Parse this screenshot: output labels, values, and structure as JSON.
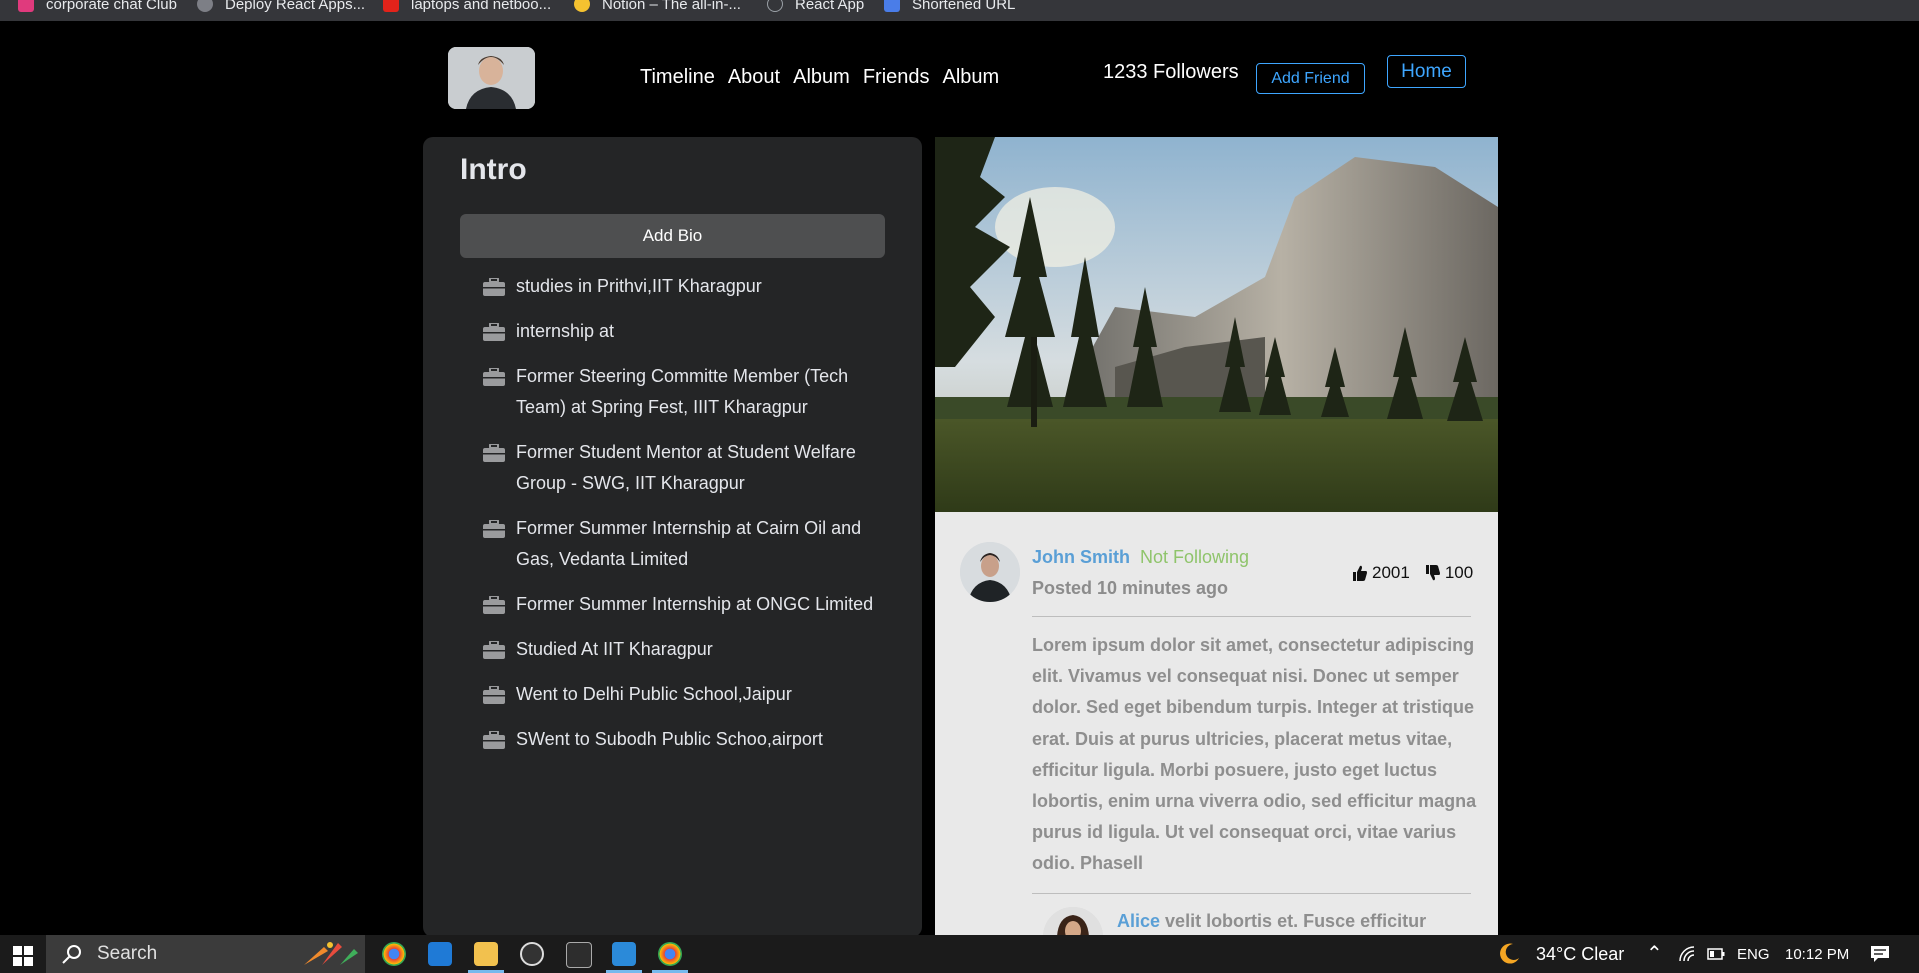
{
  "bookmarks": [
    {
      "label": "corporate chat Club",
      "icon": "purple-app-icon"
    },
    {
      "label": "Deploy React Apps...",
      "icon": "gear-like-icon"
    },
    {
      "label": "laptops and netboo...",
      "icon": "red-e-icon"
    },
    {
      "label": "Notion – The all-in-...",
      "icon": "smiley-icon"
    },
    {
      "label": "React App",
      "icon": "react-icon"
    },
    {
      "label": "Shortened URL",
      "icon": "blue-page-icon"
    }
  ],
  "header": {
    "nav": [
      "Timeline",
      "About",
      "Album",
      "Friends",
      "Album"
    ],
    "followers": "1233 Followers",
    "add_friend": "Add Friend",
    "home": "Home"
  },
  "intro": {
    "title": "Intro",
    "add_bio": "Add Bio",
    "items": [
      "studies in Prithvi,IIT Kharagpur",
      "internship at",
      "Former Steering Committe Member (Tech Team) at Spring Fest, IIIT Kharagpur",
      "Former Student Mentor at Student Welfare Group - SWG, IIT Kharagpur",
      "Former Summer Internship at Cairn Oil and Gas, Vedanta Limited",
      "Former Summer Internship at ONGC Limited",
      "Studied At IIT Kharagpur",
      "Went to Delhi Public School,Jaipur",
      "SWent to Subodh Public Schoo,airport"
    ]
  },
  "post": {
    "author": "John Smith",
    "follow_status": "Not Following",
    "posted": "Posted 10 minutes ago",
    "likes": "2001",
    "dislikes": "100",
    "body": "Lorem ipsum dolor sit amet, consectetur adipiscing elit. Vivamus vel consequat nisi. Donec ut semper dolor. Sed eget bibendum turpis. Integer at tristique erat. Duis at purus ultricies, placerat metus vitae, efficitur ligula. Morbi posuere, justo eget luctus lobortis, enim urna viverra odio, sed efficitur magna purus id ligula. Ut vel consequat orci, vitae varius odio. Phasell",
    "comment": {
      "author": "Alice",
      "text": "velit lobortis et. Fusce efficitur"
    }
  },
  "taskbar": {
    "search_label": "Search",
    "weather": "34°C  Clear",
    "language": "ENG",
    "time": "10:12 PM"
  },
  "colors": {
    "accent_blue": "#3ea6ff",
    "author_blue": "#5a9fd6",
    "status_green": "#8fc46b",
    "card_bg": "#242526"
  }
}
